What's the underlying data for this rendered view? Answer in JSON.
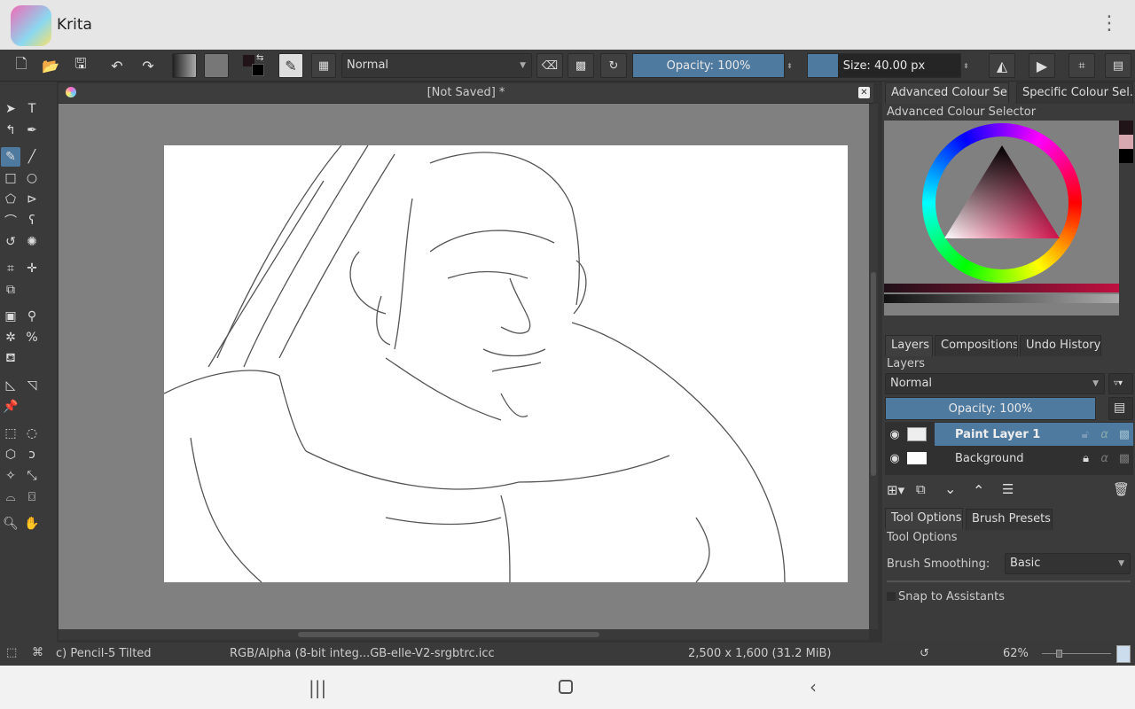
{
  "app": {
    "name": "Krita",
    "menu_icon": "kebab-menu-icon"
  },
  "toolbar": {
    "blend_mode": "Normal",
    "opacity": "Opacity: 100%",
    "opacity_value": 100,
    "size": "Size: 40.00 px",
    "size_fraction": 0.2
  },
  "document": {
    "title": "[Not Saved]  *"
  },
  "dock": {
    "colour_tabs": [
      "Advanced Colour Sel...",
      "Specific Colour Sel..."
    ],
    "colour_title": "Advanced Colour Selector",
    "layer_tabs": [
      "Layers",
      "Compositions",
      "Undo History"
    ],
    "layers_title": "Layers",
    "layer_blend": "Normal",
    "layer_opacity": "Opacity:  100%",
    "layers": [
      {
        "name": "Paint Layer 1",
        "selected": true
      },
      {
        "name": "Background",
        "selected": false
      }
    ],
    "tool_tabs": [
      "Tool Options",
      "Brush Presets"
    ],
    "tool_title": "Tool Options",
    "brush_smoothing_label": "Brush Smoothing:",
    "brush_smoothing_value": "Basic",
    "snap_label": "Snap to Assistants"
  },
  "status": {
    "brush": "c) Pencil-5 Tilted",
    "colorspace": "RGB/Alpha (8-bit integ...GB-elle-V2-srgbtrc.icc",
    "dimensions": "2,500 x 1,600 (31.2 MiB)",
    "zoom": "62%"
  },
  "colors": {
    "accent": "#4f7aa0",
    "panel": "#3b3b3b",
    "canvas_bg": "#808080"
  }
}
